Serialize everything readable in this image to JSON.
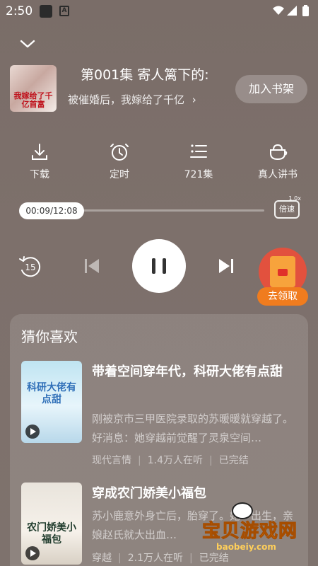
{
  "status_bar": {
    "time": "2:50",
    "app_letter": "A"
  },
  "header": {
    "cover_title": "我嫁给了千亿首富",
    "episode_title": "第001集 寄人篱下的:",
    "book_name": "被催婚后，我嫁给了千亿",
    "book_chevron": "›",
    "shelf_button": "加入书架"
  },
  "actions": [
    {
      "label": "下载",
      "icon": "download-icon"
    },
    {
      "label": "定时",
      "icon": "timer-icon"
    },
    {
      "label": "721集",
      "icon": "episode-list-icon"
    },
    {
      "label": "真人讲书",
      "icon": "human-voice-icon"
    }
  ],
  "player": {
    "time_display": "00:09/12:08",
    "progress": 0.0124,
    "speed_label": "倍速",
    "speed_value": "1.0x",
    "rewind_seconds": "15",
    "state": "playing"
  },
  "reward": {
    "label": "去领取"
  },
  "recommend": {
    "title": "猜你喜欢",
    "items": [
      {
        "cover_title": "科研大佬有点甜",
        "title": "带着空间穿年代，科研大佬有点甜",
        "desc": "刚被京市三甲医院录取的苏暖暖就穿越了。好消息：她穿越前觉醒了灵泉空间…",
        "category": "现代言情",
        "listeners": "1.4万人在听",
        "status": "已完结"
      },
      {
        "cover_title": "农门娇美小福包",
        "title": "穿成农门娇美小福包",
        "desc": "苏小鹿意外身亡后，胎穿了。她一出生，亲娘赵氏就大出血…",
        "category": "穿越",
        "listeners": "2.1万人在听",
        "status": "已完结"
      }
    ]
  },
  "watermark": {
    "text": "宝贝游戏网",
    "url": "baobeiy.com"
  },
  "colors": {
    "accent_orange": "#f07c1e",
    "reward_red": "#e2513e",
    "background": "#7a6d68"
  }
}
